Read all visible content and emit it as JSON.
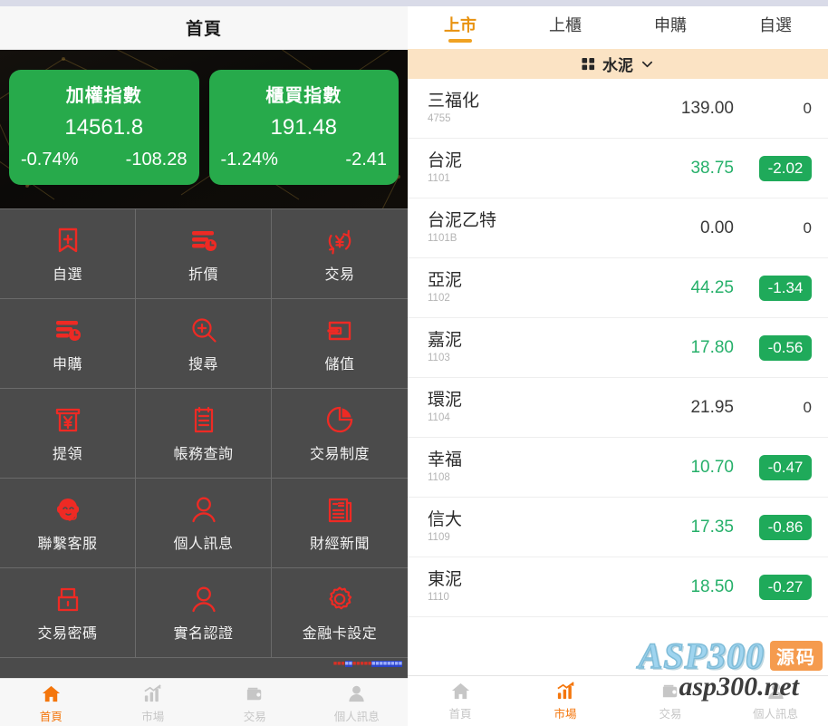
{
  "home": {
    "header_title": "首頁",
    "indices": [
      {
        "name": "加權指數",
        "value": "14561.8",
        "percent": "-0.74%",
        "change": "-108.28",
        "color": "#27aa4b"
      },
      {
        "name": "櫃買指數",
        "value": "191.48",
        "percent": "-1.24%",
        "change": "-2.41",
        "color": "#27aa4b"
      }
    ],
    "menu": [
      {
        "label": "自選",
        "icon": "bookmark-plus-icon"
      },
      {
        "label": "折價",
        "icon": "list-clock-icon"
      },
      {
        "label": "交易",
        "icon": "yen-refresh-icon"
      },
      {
        "label": "申購",
        "icon": "list-clock-icon"
      },
      {
        "label": "搜尋",
        "icon": "search-plus-icon"
      },
      {
        "label": "儲值",
        "icon": "wallet-in-icon"
      },
      {
        "label": "提領",
        "icon": "atm-yen-icon"
      },
      {
        "label": "帳務查詢",
        "icon": "clipboard-list-icon"
      },
      {
        "label": "交易制度",
        "icon": "pie-chart-icon"
      },
      {
        "label": "聯繫客服",
        "icon": "headset-agent-icon"
      },
      {
        "label": "個人訊息",
        "icon": "user-icon"
      },
      {
        "label": "財經新聞",
        "icon": "newspaper-icon"
      },
      {
        "label": "交易密碼",
        "icon": "lock-icon"
      },
      {
        "label": "實名認證",
        "icon": "user-icon"
      },
      {
        "label": "金融卡設定",
        "icon": "gear-icon"
      }
    ],
    "icon_color": "#ee2a24",
    "bottom_nav": [
      {
        "label": "首頁",
        "icon": "home-icon",
        "active": true
      },
      {
        "label": "市場",
        "icon": "chart-icon",
        "active": false
      },
      {
        "label": "交易",
        "icon": "wallet-icon",
        "active": false
      },
      {
        "label": "個人訊息",
        "icon": "user-icon",
        "active": false
      }
    ]
  },
  "market": {
    "tabs": [
      {
        "label": "上市",
        "active": true
      },
      {
        "label": "上櫃",
        "active": false
      },
      {
        "label": "申購",
        "active": false
      },
      {
        "label": "自選",
        "active": false
      }
    ],
    "category": {
      "label": "水泥",
      "grid_icon": "grid-icon",
      "chevron": "chevron-down-icon",
      "bg": "#fbe3c4"
    },
    "stocks": [
      {
        "name": "三福化",
        "code": "4755",
        "price": "139.00",
        "change": "0",
        "state": "flat"
      },
      {
        "name": "台泥",
        "code": "1101",
        "price": "38.75",
        "change": "-2.02",
        "state": "down"
      },
      {
        "name": "台泥乙特",
        "code": "1101B",
        "price": "0.00",
        "change": "0",
        "state": "flat"
      },
      {
        "name": "亞泥",
        "code": "1102",
        "price": "44.25",
        "change": "-1.34",
        "state": "down"
      },
      {
        "name": "嘉泥",
        "code": "1103",
        "price": "17.80",
        "change": "-0.56",
        "state": "down"
      },
      {
        "name": "環泥",
        "code": "1104",
        "price": "21.95",
        "change": "0",
        "state": "flat"
      },
      {
        "name": "幸福",
        "code": "1108",
        "price": "10.70",
        "change": "-0.47",
        "state": "down"
      },
      {
        "name": "信大",
        "code": "1109",
        "price": "17.35",
        "change": "-0.86",
        "state": "down"
      },
      {
        "name": "東泥",
        "code": "1110",
        "price": "18.50",
        "change": "-0.27",
        "state": "down"
      }
    ],
    "accent_down": "#1faa5a",
    "accent_tab": "#e8920f",
    "bottom_nav": [
      {
        "label": "首頁",
        "icon": "home-icon",
        "active": false
      },
      {
        "label": "市場",
        "icon": "chart-icon",
        "active": true
      },
      {
        "label": "交易",
        "icon": "wallet-icon",
        "active": false
      },
      {
        "label": "個人訊息",
        "icon": "user-icon",
        "active": false
      }
    ]
  },
  "watermark": {
    "brand": "ASP300",
    "badge": "源码",
    "domain": "asp300.net"
  }
}
